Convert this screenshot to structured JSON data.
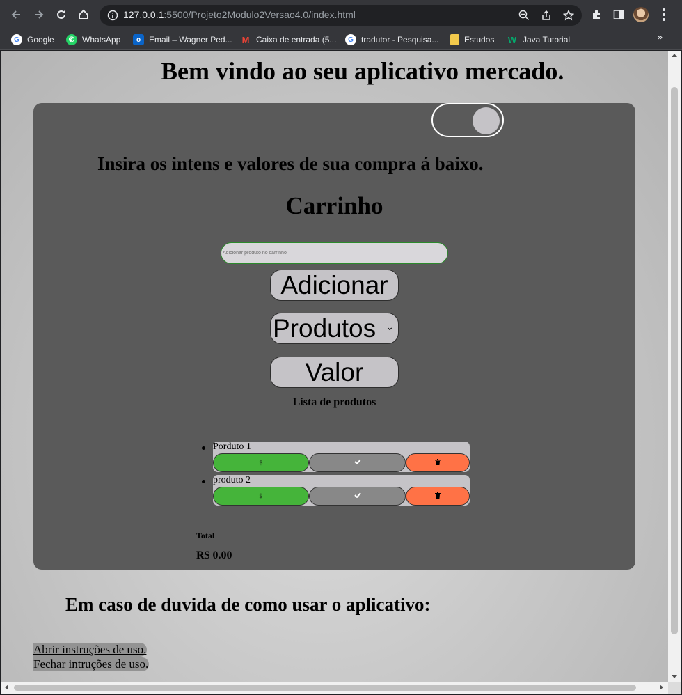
{
  "browser": {
    "url_host": "127.0.0.1",
    "url_path": ":5500/Projeto2Modulo2Versao4.0/index.html",
    "bookmarks": [
      {
        "label": "Google",
        "icon": "google-icon"
      },
      {
        "label": "WhatsApp",
        "icon": "whatsapp-icon"
      },
      {
        "label": "Email – Wagner Ped...",
        "icon": "outlook-icon"
      },
      {
        "label": "Caixa de entrada (5...",
        "icon": "gmail-icon"
      },
      {
        "label": "tradutor - Pesquisa...",
        "icon": "google-icon"
      },
      {
        "label": "Estudos",
        "icon": "folder-icon"
      },
      {
        "label": "Java Tutorial",
        "icon": "w3schools-icon"
      }
    ],
    "more": "»"
  },
  "page": {
    "welcome": "Bem vindo ao seu aplicativo mercado.",
    "instructions": "Insira os intens e valores de sua compra á baixo.",
    "cart_title": "Carrinho",
    "input_placeholder": "Adicionar produto no carrinho",
    "add_button": "Adicionar",
    "products_select": "Produtos",
    "value_button": "Valor",
    "list_title": "Lista de produtos",
    "products": [
      {
        "name": "Porduto 1",
        "money_symbol": "$"
      },
      {
        "name": "produto 2",
        "money_symbol": "$"
      }
    ],
    "total_label": "Total",
    "total_value": "R$ 0.00",
    "help_heading": "Em caso de duvida de como usar o aplicativo:",
    "open_instructions": "Abrir instruções de uso.",
    "close_instructions": "Fechar intruções de uso."
  },
  "colors": {
    "panel": "#5a5a5a",
    "money_button": "#45b43a",
    "check_button": "#888888",
    "trash_button": "#ff7246",
    "pill": "#c5c3c7"
  }
}
